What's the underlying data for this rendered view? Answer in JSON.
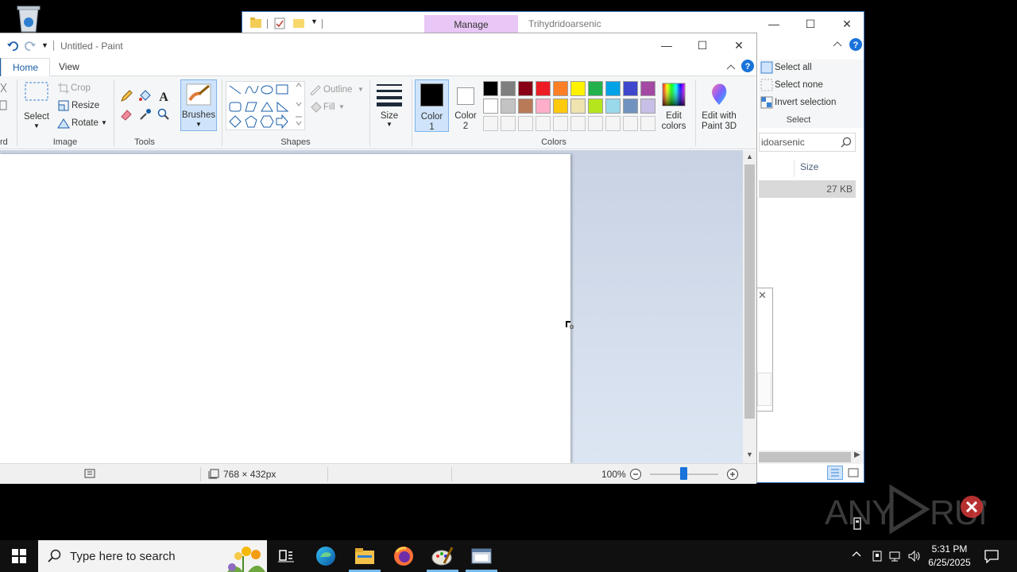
{
  "explorer": {
    "manage_tab": "Manage",
    "title": "Trihydridoarsenic",
    "select": {
      "select_all": "Select all",
      "select_none": "Select none",
      "invert_selection": "Invert selection",
      "group_label": "Select"
    },
    "search_text": "idoarsenic",
    "column_size": "Size",
    "file_size": "27 KB"
  },
  "paint": {
    "title": "Untitled - Paint",
    "tabs": {
      "home": "Home",
      "view": "View"
    },
    "clipboard_label_fragment": "rd",
    "select_label": "Select",
    "image": {
      "crop": "Crop",
      "resize": "Resize",
      "rotate": "Rotate",
      "group_label": "Image"
    },
    "tools": {
      "group_label": "Tools"
    },
    "brushes_label": "Brushes",
    "shapes": {
      "outline": "Outline",
      "fill": "Fill",
      "group_label": "Shapes"
    },
    "size_label": "Size",
    "color1": {
      "line1": "Color",
      "line2": "1"
    },
    "color2": {
      "line1": "Color",
      "line2": "2"
    },
    "colors_group_label": "Colors",
    "edit_colors": {
      "line1": "Edit",
      "line2": "colors"
    },
    "edit_paint3d": {
      "line1": "Edit with",
      "line2": "Paint 3D"
    },
    "palette_row1": [
      "#000000",
      "#7f7f7f",
      "#880015",
      "#ed1c24",
      "#ff7f27",
      "#fff200",
      "#22b14c",
      "#00a2e8",
      "#3f48cc",
      "#a349a4"
    ],
    "palette_row2": [
      "#ffffff",
      "#c3c3c3",
      "#b97a57",
      "#ffaec9",
      "#ffc90e",
      "#efe4b0",
      "#b5e61d",
      "#99d9ea",
      "#7092be",
      "#c8bfe7"
    ],
    "palette_row3": [
      "#f5f5f5",
      "#f5f5f5",
      "#f5f5f5",
      "#f5f5f5",
      "#f5f5f5",
      "#f5f5f5",
      "#f5f5f5",
      "#f5f5f5",
      "#f5f5f5",
      "#f5f5f5"
    ],
    "status": {
      "dimensions": "768 × 432px",
      "zoom": "100%"
    }
  },
  "taskbar": {
    "search_placeholder": "Type here to search",
    "time": "5:31 PM",
    "date": "6/25/2025"
  },
  "watermark": "ANY RUN"
}
